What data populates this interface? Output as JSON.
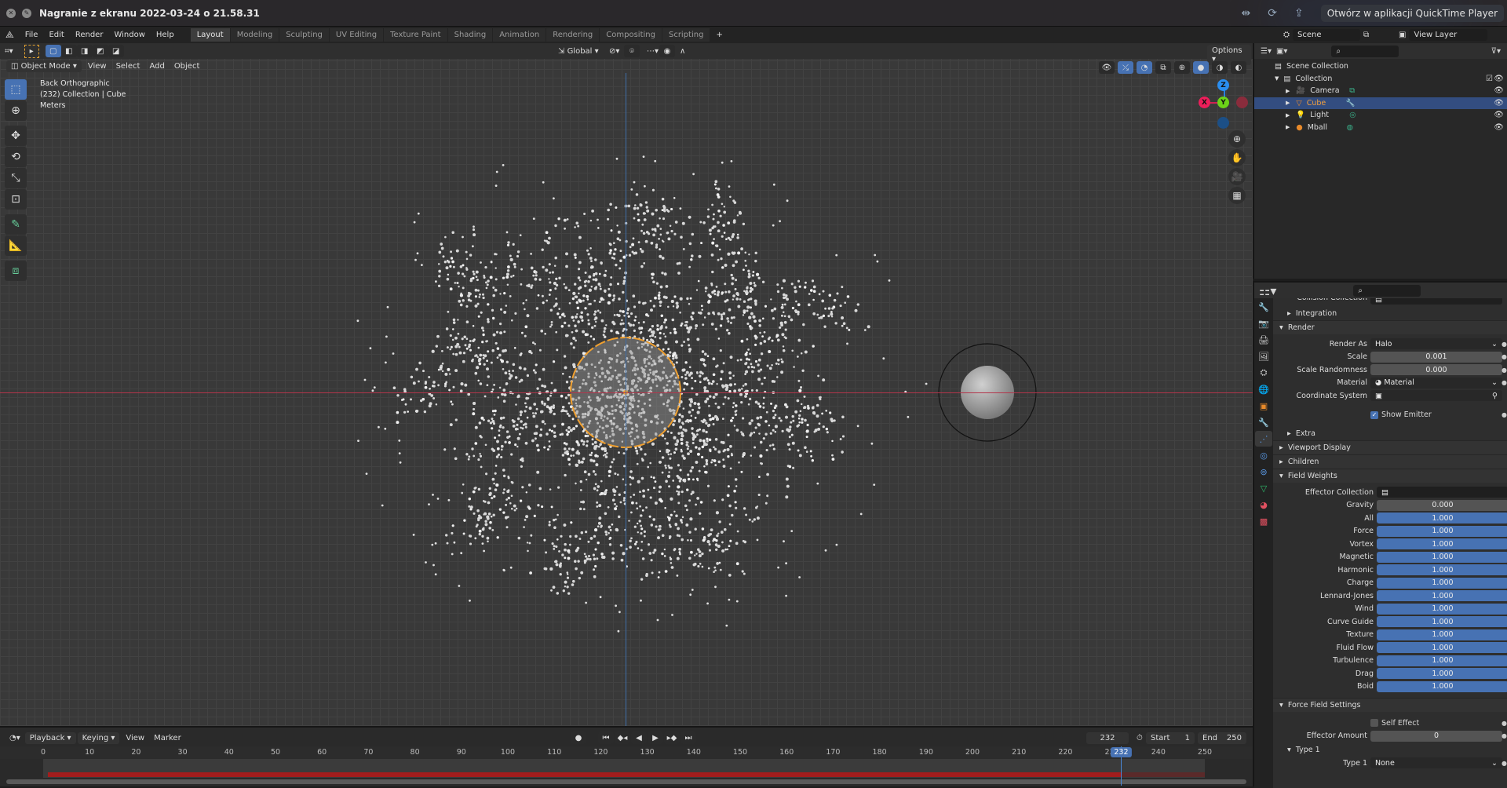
{
  "quicktime": {
    "title": "Nagranie z ekranu 2022-03-24 o 21.58.31",
    "open_button": "Otwórz w aplikacji QuickTime Player",
    "icons": [
      "close-icon",
      "edit-icon",
      "trim-icon",
      "rotate-icon",
      "share-icon"
    ]
  },
  "menu": [
    "File",
    "Edit",
    "Render",
    "Window",
    "Help"
  ],
  "workspaces": [
    "Layout",
    "Modeling",
    "Sculpting",
    "UV Editing",
    "Texture Paint",
    "Shading",
    "Animation",
    "Rendering",
    "Compositing",
    "Scripting"
  ],
  "active_workspace": "Layout",
  "scene": {
    "name": "Scene",
    "view_layer": "View Layer"
  },
  "viewport": {
    "orientation": "Global",
    "options_label": "Options",
    "mode": "Object Mode",
    "menus": [
      "View",
      "Select",
      "Add",
      "Object"
    ],
    "info": [
      "Back Orthographic",
      "(232) Collection | Cube",
      "Meters"
    ],
    "gizmo": {
      "x": "X",
      "y": "Y",
      "z": "Z"
    },
    "tools": [
      "select-box",
      "cursor",
      "move",
      "rotate",
      "scale",
      "transform",
      "annotate",
      "measure",
      "add-cube"
    ]
  },
  "outliner": {
    "root": "Scene Collection",
    "collection": "Collection",
    "items": [
      {
        "name": "Camera",
        "selected": false
      },
      {
        "name": "Cube",
        "selected": true
      },
      {
        "name": "Light",
        "selected": false
      },
      {
        "name": "Mball",
        "selected": false
      }
    ]
  },
  "properties": {
    "collision_collection_label": "Collision Collection",
    "integration": "Integration",
    "render_section": "Render",
    "render_as_label": "Render As",
    "render_as": "Halo",
    "scale_label": "Scale",
    "scale": "0.001",
    "scale_rand_label": "Scale Randomness",
    "scale_rand": "0.000",
    "material_label": "Material",
    "material": "Material",
    "coord_label": "Coordinate System",
    "show_emitter": "Show Emitter",
    "extra": "Extra",
    "viewport_display": "Viewport Display",
    "children": "Children",
    "field_weights": "Field Weights",
    "effector_collection": "Effector Collection",
    "gravity_label": "Gravity",
    "gravity": "0.000",
    "weights": [
      {
        "label": "All",
        "value": "1.000"
      },
      {
        "label": "Force",
        "value": "1.000"
      },
      {
        "label": "Vortex",
        "value": "1.000"
      },
      {
        "label": "Magnetic",
        "value": "1.000"
      },
      {
        "label": "Harmonic",
        "value": "1.000"
      },
      {
        "label": "Charge",
        "value": "1.000"
      },
      {
        "label": "Lennard-Jones",
        "value": "1.000"
      },
      {
        "label": "Wind",
        "value": "1.000"
      },
      {
        "label": "Curve Guide",
        "value": "1.000"
      },
      {
        "label": "Texture",
        "value": "1.000"
      },
      {
        "label": "Fluid Flow",
        "value": "1.000"
      },
      {
        "label": "Turbulence",
        "value": "1.000"
      },
      {
        "label": "Drag",
        "value": "1.000"
      },
      {
        "label": "Boid",
        "value": "1.000"
      }
    ],
    "force_field_settings": "Force Field Settings",
    "self_effect": "Self Effect",
    "effector_amount_label": "Effector Amount",
    "effector_amount": "0",
    "type1_section": "Type 1",
    "type1_label": "Type 1",
    "type1_value": "None"
  },
  "timeline": {
    "menus": [
      "Playback",
      "Keying",
      "View",
      "Marker"
    ],
    "current_frame": "232",
    "start_label": "Start",
    "start": "1",
    "end_label": "End",
    "end": "250",
    "ticks": [
      "0",
      "10",
      "20",
      "30",
      "40",
      "50",
      "60",
      "70",
      "80",
      "90",
      "100",
      "110",
      "120",
      "130",
      "140",
      "150",
      "160",
      "170",
      "180",
      "190",
      "200",
      "210",
      "220",
      "230",
      "240",
      "250"
    ]
  }
}
